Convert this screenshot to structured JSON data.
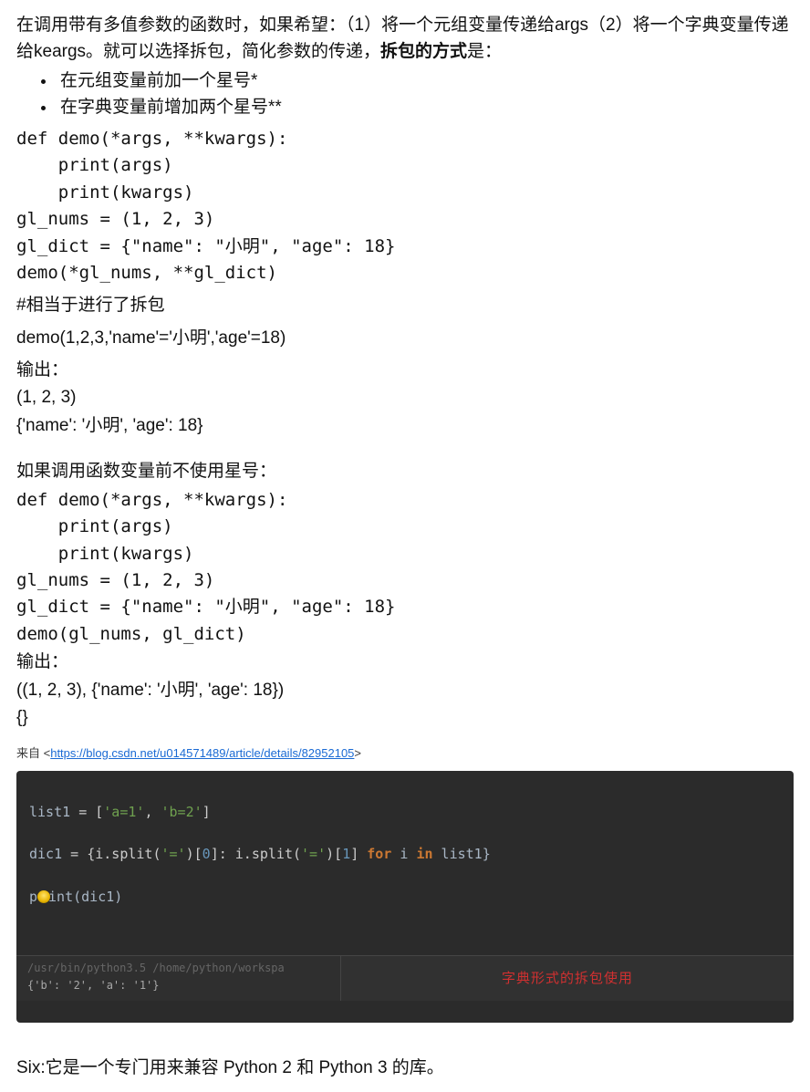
{
  "intro_line1": "在调用带有多值参数的函数时，如果希望：（1）将一个元组变量传递给args（2）将一个字典变量传递给keargs。就可以选择拆包，简化参数的传递，",
  "intro_bold": "拆包的方式",
  "intro_tail": "是：",
  "bullets": [
    "在元组变量前加一个星号*",
    "在字典变量前增加两个星号**"
  ],
  "code1": "def demo(*args, **kwargs):\n    print(args)\n    print(kwargs)\ngl_nums = (1, 2, 3)\ngl_dict = {\"name\": \"小明\", \"age\": 18}\ndemo(*gl_nums, **gl_dict)",
  "comment1": "#相当于进行了拆包",
  "demo_call": "demo(1,2,3,'name'='小明','age'=18)",
  "output_label1": "输出：",
  "out1_line1": "(1, 2, 3)",
  "out1_line2": "{'name': '小明', 'age': 18}",
  "nostar_intro": "如果调用函数变量前不使用星号：",
  "code2": "def demo(*args, **kwargs):\n    print(args)\n    print(kwargs)\ngl_nums = (1, 2, 3)\ngl_dict = {\"name\": \"小明\", \"age\": 18}\ndemo(gl_nums, gl_dict)",
  "output_label2": "输出：",
  "out2_line1": "((1, 2, 3), {'name': '小明', 'age': 18})",
  "out2_line2": "{}",
  "source_prefix": "来自 <",
  "source_url": "https://blog.csdn.net/u014571489/article/details/82952105",
  "source_suffix": ">",
  "dark": {
    "l1": {
      "a": "list1 ",
      "b": "= [",
      "c": "'a=1'",
      "d": ", ",
      "e": "'b=2'",
      "f": "]"
    },
    "l2": {
      "a": "dic1 ",
      "b": "= {i.split(",
      "c": "'='",
      "d": ")[",
      "e": "0",
      "f": "]: i.split(",
      "g": "'='",
      "h": ")[",
      "i": "1",
      "j": "] ",
      "k": "for",
      "l": " i ",
      "m": "in",
      "n": " list1}"
    },
    "l3": {
      "a": "p",
      "b": "int(dic1)"
    },
    "out_path": "/usr/bin/python3.5 /home/python/workspa",
    "out_val": "{'b': '2', 'a': '1'}",
    "red": "字典形式的拆包使用"
  },
  "six_line": "Six:它是一个专门用来兼容 Python 2 和 Python 3 的库。"
}
